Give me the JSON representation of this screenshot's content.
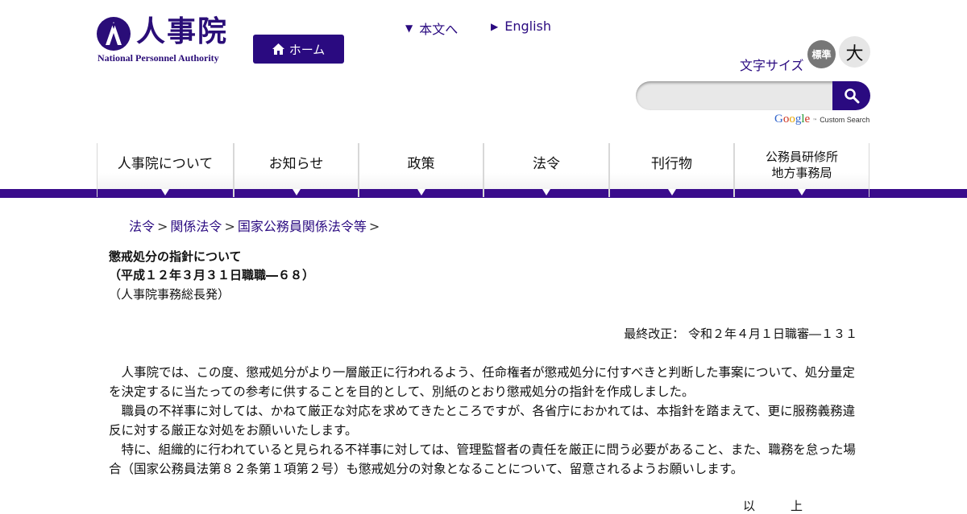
{
  "header": {
    "logo_jp": "人事院",
    "logo_en": "National Personnel Authority",
    "home_label": "ホーム",
    "skip_link": "本文へ",
    "english_link": "English",
    "font_size_label": "文字サイズ",
    "font_size_standard": "標準",
    "font_size_large": "大",
    "search_placeholder": "",
    "google_label": "Google",
    "custom_search_label": "Custom Search"
  },
  "nav": {
    "items": [
      {
        "label": "人事院について"
      },
      {
        "label": "お知らせ"
      },
      {
        "label": "政策"
      },
      {
        "label": "法令"
      },
      {
        "label": "刊行物"
      },
      {
        "label_line1": "公務員研修所",
        "label_line2": "地方事務局"
      }
    ]
  },
  "breadcrumb": {
    "items": [
      "法令",
      "関係法令",
      "国家公務員関係法令等"
    ],
    "separator": ">"
  },
  "document": {
    "title": "懲戒処分の指針について",
    "reference": "（平成１２年３月３１日職職―６８）",
    "issuer": "（人事院事務総長発）",
    "revision": "最終改正： 令和２年４月１日職審―１３１",
    "paragraphs": [
      "人事院では、この度、懲戒処分がより一層厳正に行われるよう、任命権者が懲戒処分に付すべきと判断した事案について、処分量定を決定するに当たっての参考に供することを目的として、別紙のとおり懲戒処分の指針を作成しました。",
      "職員の不祥事に対しては、かねて厳正な対応を求めてきたところですが、各省庁におかれては、本指針を踏まえて、更に服務義務違反に対する厳正な対処をお願いいたします。",
      "特に、組織的に行われていると見られる不祥事に対しては、管理監督者の責任を厳正に問う必要があること、また、職務を怠った場合（国家公務員法第８２条第１項第２号）も懲戒処分の対象となることについて、留意されるようお願いします。"
    ],
    "cut_text": "以上"
  },
  "colors": {
    "brand": "#2a0a80",
    "nav_band": "#3a0c8c",
    "font_size_standard_bg": "#777777",
    "font_size_large_bg": "#e6e6e6"
  }
}
